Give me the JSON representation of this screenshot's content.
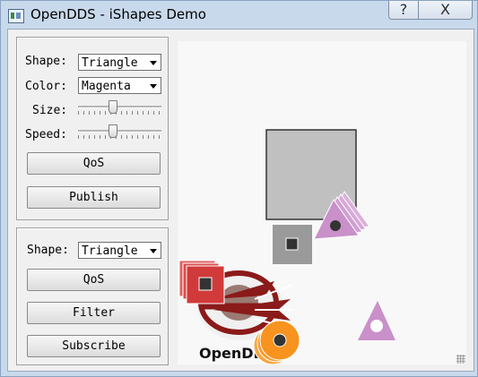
{
  "window": {
    "title": "OpenDDS - iShapes Demo",
    "help_glyph": "?",
    "close_glyph": "X"
  },
  "publisher": {
    "shape_label": "Shape:",
    "shape_value": "Triangle",
    "color_label": "Color:",
    "color_value": "Magenta",
    "size_label": "Size:",
    "speed_label": "Speed:",
    "qos_button": "QoS",
    "publish_button": "Publish"
  },
  "subscriber": {
    "shape_label": "Shape:",
    "shape_value": "Triangle",
    "qos_button": "QoS",
    "filter_button": "Filter",
    "subscribe_button": "Subscribe"
  },
  "canvas": {
    "logo_text": "OpenDDS"
  },
  "colors": {
    "window_frame": "#c9d9ec",
    "square_gray": "#c0c0c0",
    "square_dark_gray": "#9a9a9a",
    "red": "#d13a3a",
    "magenta": "#c990c9",
    "orange": "#f7931e",
    "logo_maroon": "#8b1a1a"
  }
}
